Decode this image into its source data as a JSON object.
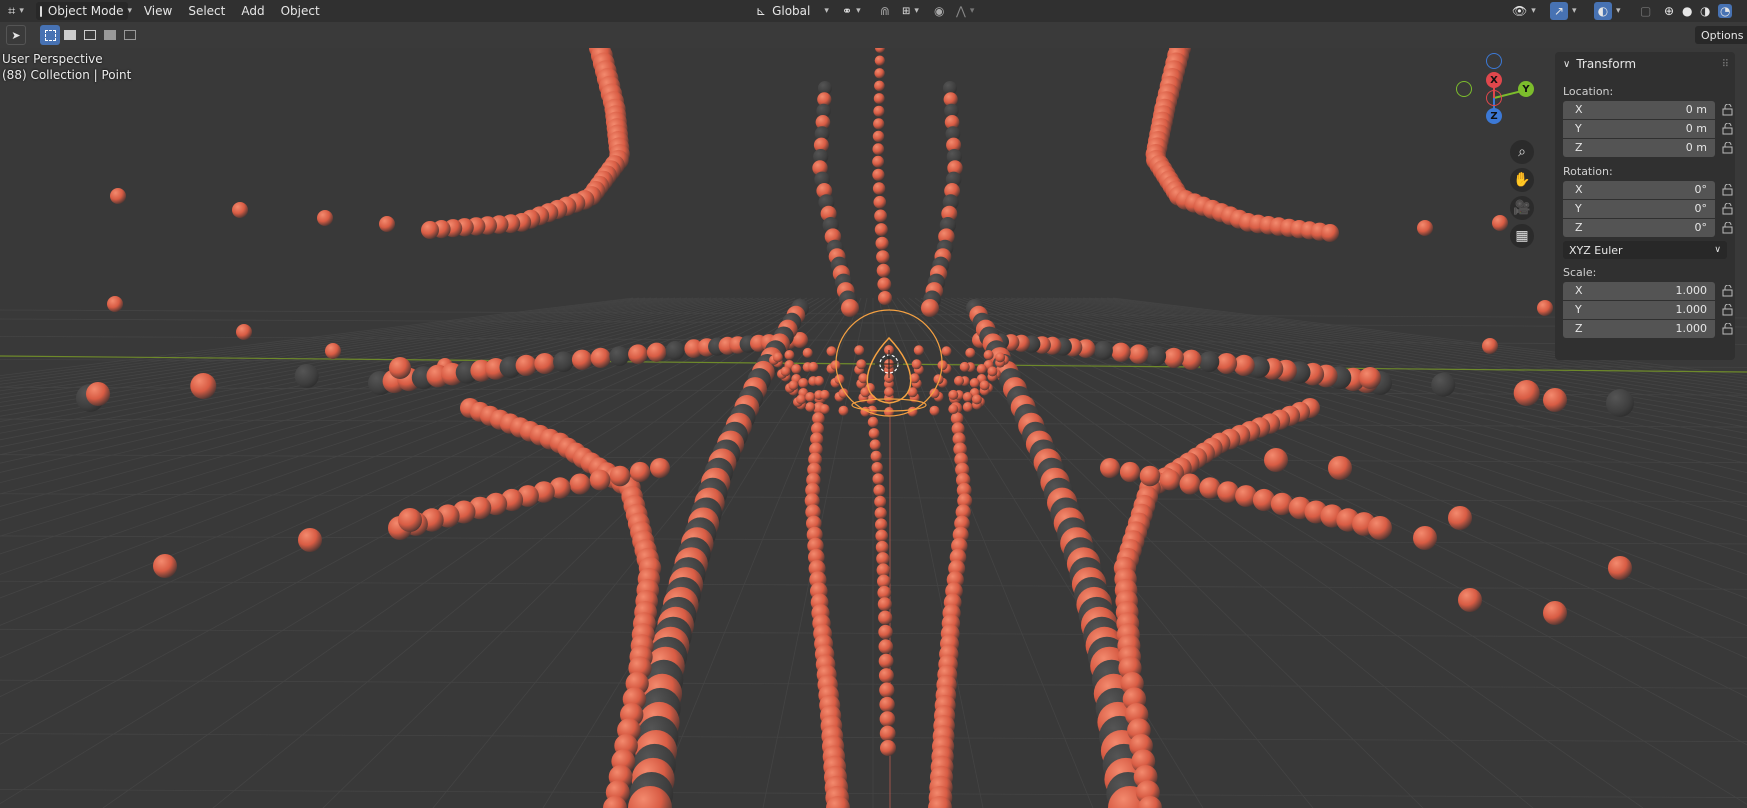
{
  "header": {
    "mode_label": "Object Mode",
    "menus": [
      "View",
      "Select",
      "Add",
      "Object"
    ],
    "orientation_label": "Global"
  },
  "toolbar": {
    "options_label": "Options"
  },
  "viewport": {
    "view_name": "User Perspective",
    "collection_info": "(88) Collection | Point",
    "gizmo": {
      "x": "X",
      "y": "Y",
      "z": "Z"
    }
  },
  "transform_panel": {
    "title": "Transform",
    "location_label": "Location:",
    "location": [
      {
        "axis": "X",
        "value": "0 m"
      },
      {
        "axis": "Y",
        "value": "0 m"
      },
      {
        "axis": "Z",
        "value": "0 m"
      }
    ],
    "rotation_label": "Rotation:",
    "rotation": [
      {
        "axis": "X",
        "value": "0°"
      },
      {
        "axis": "Y",
        "value": "0°"
      },
      {
        "axis": "Z",
        "value": "0°"
      }
    ],
    "rotation_mode": "XYZ Euler",
    "scale_label": "Scale:",
    "scale": [
      {
        "axis": "X",
        "value": "1.000"
      },
      {
        "axis": "Y",
        "value": "1.000"
      },
      {
        "axis": "Z",
        "value": "1.000"
      }
    ]
  },
  "colors": {
    "sphere": "#e8644a",
    "selection": "#ffa040",
    "x_axis_line": "#7a9a2a",
    "gizmo_x": "#e0474c",
    "gizmo_y": "#7cbd2c",
    "gizmo_z": "#3c79d6"
  }
}
